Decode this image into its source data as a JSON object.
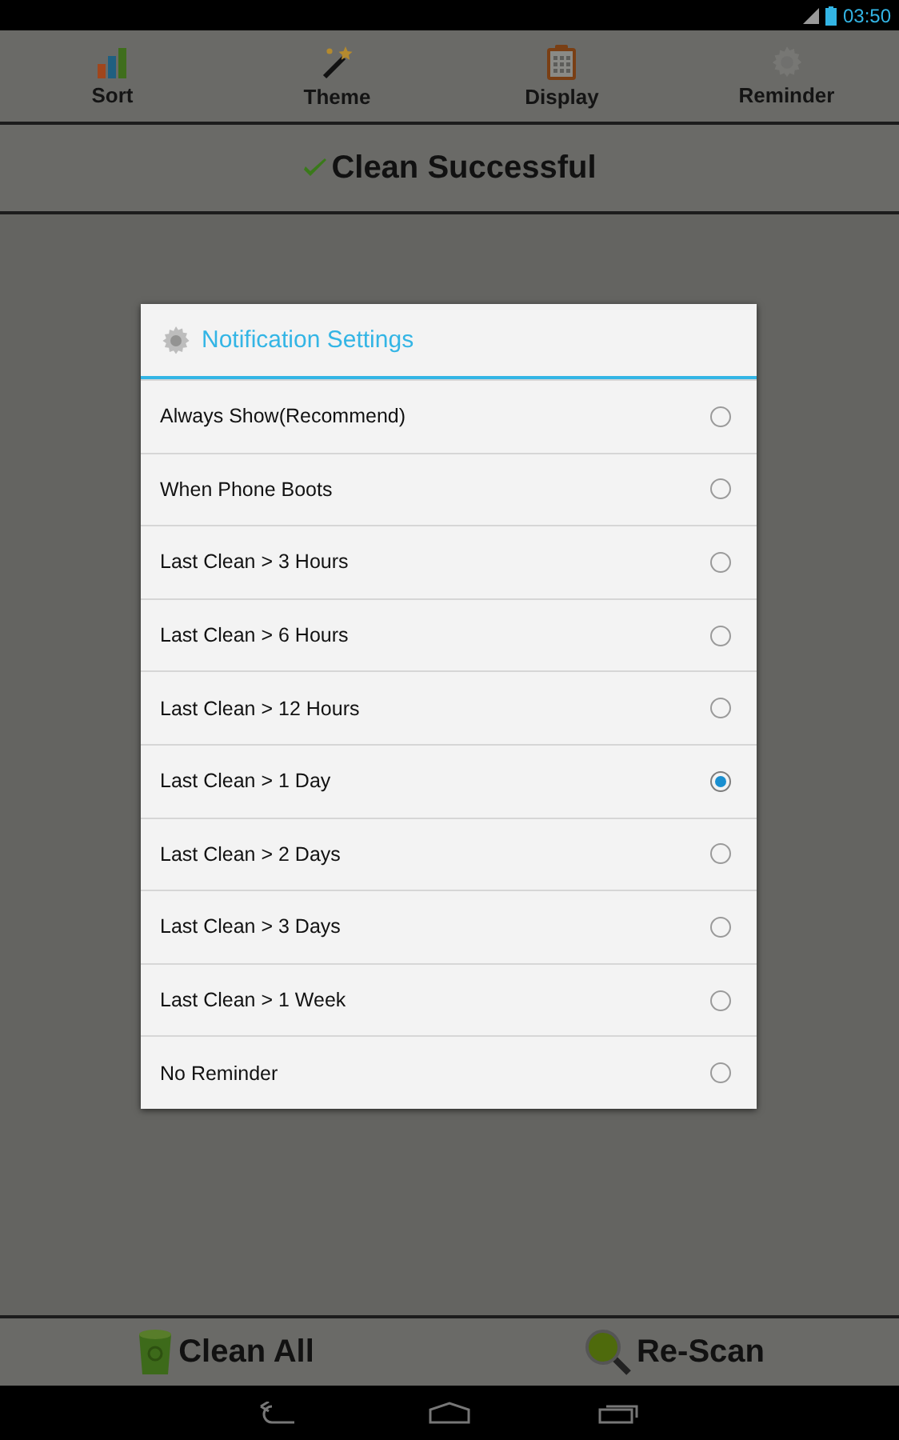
{
  "status_bar": {
    "time": "03:50"
  },
  "toolbar": [
    {
      "label": "Sort",
      "kind": "bars"
    },
    {
      "label": "Theme",
      "kind": "wand"
    },
    {
      "label": "Display",
      "kind": "clipboard"
    },
    {
      "label": "Reminder",
      "kind": "gear"
    }
  ],
  "banner": {
    "text": "Clean Successful"
  },
  "dialog": {
    "title": "Notification Settings",
    "options": [
      {
        "label": "Always Show(Recommend)",
        "selected": false
      },
      {
        "label": "When Phone Boots",
        "selected": false
      },
      {
        "label": "Last Clean > 3 Hours",
        "selected": false
      },
      {
        "label": "Last Clean > 6 Hours",
        "selected": false
      },
      {
        "label": "Last Clean > 12 Hours",
        "selected": false
      },
      {
        "label": "Last Clean > 1 Day",
        "selected": true
      },
      {
        "label": "Last Clean > 2 Days",
        "selected": false
      },
      {
        "label": "Last Clean > 3 Days",
        "selected": false
      },
      {
        "label": "Last Clean > 1 Week",
        "selected": false
      },
      {
        "label": "No Reminder",
        "selected": false
      }
    ]
  },
  "bottom_bar": [
    {
      "label": "Clean All",
      "kind": "bin"
    },
    {
      "label": "Re-Scan",
      "kind": "magnifier"
    }
  ]
}
